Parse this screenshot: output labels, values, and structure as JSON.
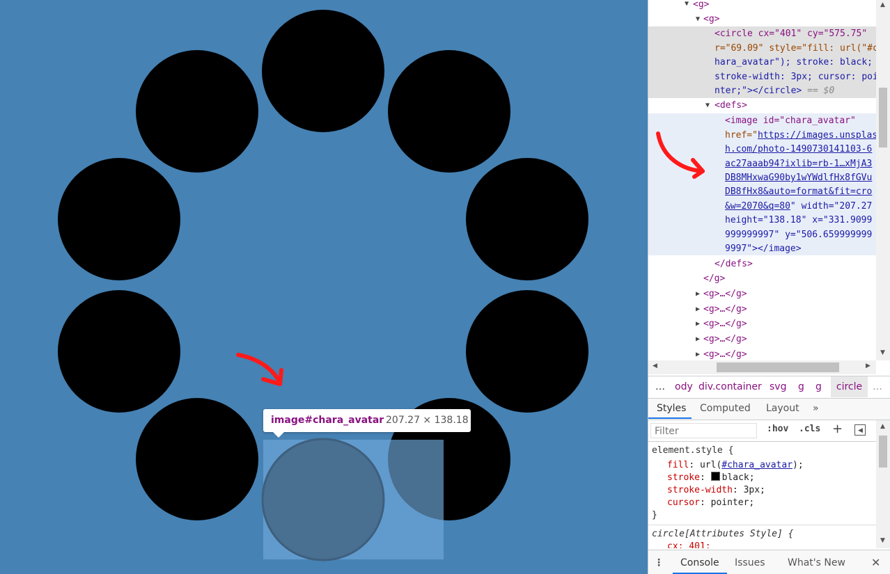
{
  "page": {
    "background_color": "#4682b4",
    "tooltip": {
      "tag": "image#chara_avatar",
      "size": "207.27 × 138.18"
    }
  },
  "elements_panel": {
    "lines": {
      "g_outer": "<g>",
      "g_inner": "<g>",
      "circle_1": "<circle cx=\"401\" cy=\"575.75\"",
      "circle_2": "r=\"69.09\" style=\"fill: url(\"#c",
      "circle_3": "hara_avatar\"); stroke: black;",
      "circle_4": "stroke-width: 3px; cursor: poi",
      "circle_5": "nter;\"></circle>",
      "circle_marker": "== $0",
      "defs_open": "<defs>",
      "image_1": "<image id=\"chara_avatar\"",
      "image_2_prefix": "href=\"",
      "image_2_link": "https://images.unsplas",
      "image_3": "h.com/photo-1490730141103-6",
      "image_4": "ac27aaab94?ixlib=rb-1…xMjA3",
      "image_5": "DB8MHxwaG90by1wYWdlfHx8fGVu",
      "image_6": "DB8fHx8&auto=format&fit=cro",
      "image_7_link": "&w=2070&q=80",
      "image_7_rest": "\" width=\"207.27",
      "image_8": "height=\"138.18\" x=\"331.9099",
      "image_9": "999999997\" y=\"506.659999999",
      "image_10": "9997\"></image>",
      "defs_close": "</defs>",
      "g_close": "</g>",
      "collapsed_g": "<g>…</g>"
    }
  },
  "breadcrumbs": [
    "…",
    "ody",
    "div.container",
    "svg",
    "g",
    "g",
    "circle",
    "…"
  ],
  "tabs": [
    "Styles",
    "Computed",
    "Layout",
    "»"
  ],
  "styles_pane": {
    "filter_placeholder": "Filter",
    "hov": ":hov",
    "cls": ".cls",
    "element_style_selector": "element.style {",
    "rules": [
      {
        "prop": "fill",
        "value": "url(",
        "link": "#chara_avatar",
        "tail": ");"
      },
      {
        "prop": "stroke",
        "value": "black;"
      },
      {
        "prop": "stroke-width",
        "value": "3px;"
      },
      {
        "prop": "cursor",
        "value": "pointer;"
      }
    ],
    "close_brace": "}",
    "attr_style_selector": "circle[Attributes Style] {",
    "attr_first_rule": "cx: 401;"
  },
  "drawer": {
    "tabs": [
      "Console",
      "Issues",
      "What's New"
    ],
    "close": "✕"
  }
}
